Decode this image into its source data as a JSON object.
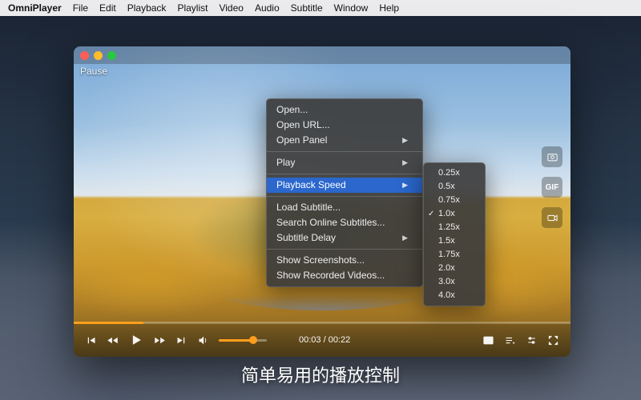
{
  "menubar": {
    "app": "OmniPlayer",
    "items": [
      "File",
      "Edit",
      "Playback",
      "Playlist",
      "Video",
      "Audio",
      "Subtitle",
      "Window",
      "Help"
    ]
  },
  "window": {
    "state_label": "Pause"
  },
  "context_menu": {
    "group1": [
      {
        "label": "Open...",
        "arrow": false
      },
      {
        "label": "Open URL...",
        "arrow": false
      },
      {
        "label": "Open Panel",
        "arrow": true
      }
    ],
    "group2": [
      {
        "label": "Play",
        "arrow": true
      }
    ],
    "group3": [
      {
        "label": "Playback Speed",
        "arrow": true,
        "selected": true
      }
    ],
    "group4": [
      {
        "label": "Load Subtitle...",
        "arrow": false
      },
      {
        "label": "Search Online Subtitles...",
        "arrow": false
      },
      {
        "label": "Subtitle Delay",
        "arrow": true
      }
    ],
    "group5": [
      {
        "label": "Show Screenshots...",
        "arrow": false
      },
      {
        "label": "Show Recorded Videos...",
        "arrow": false
      }
    ]
  },
  "speed_submenu": {
    "options": [
      "0.25x",
      "0.5x",
      "0.75x",
      "1.0x",
      "1.25x",
      "1.5x",
      "1.75x",
      "2.0x",
      "3.0x",
      "4.0x"
    ],
    "checked": "1.0x"
  },
  "side_icons": {
    "screenshot": "screenshot",
    "gif": "GIF",
    "record": "record"
  },
  "controls": {
    "time_current": "00:03",
    "time_total": "00:22",
    "time_display": "00:03 / 00:22"
  },
  "caption": "简单易用的播放控制"
}
